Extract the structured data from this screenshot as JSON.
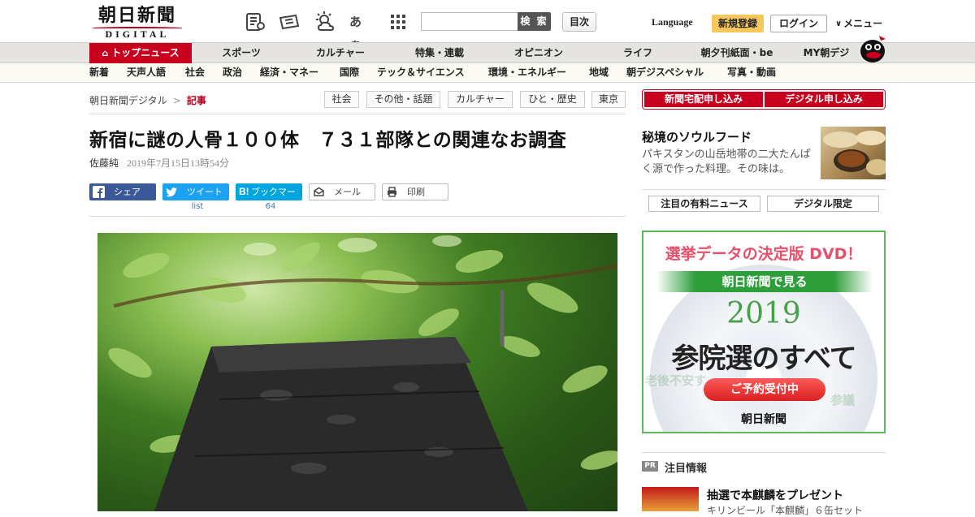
{
  "header": {
    "logo_jp": "朝日新聞",
    "logo_en": "DIGITAL",
    "font_icon_label": "あぁ",
    "search": {
      "placeholder": "",
      "button_label": "検 索"
    },
    "toc_label": "目次",
    "language_label": "Language",
    "register_label": "新規登録",
    "login_label": "ログイン",
    "menu_label": "メニュー"
  },
  "nav_primary": [
    {
      "label": "トップニュース",
      "active": true
    },
    {
      "label": "スポーツ"
    },
    {
      "label": "カルチャー"
    },
    {
      "label": "特集・連載"
    },
    {
      "label": "オピニオン"
    },
    {
      "label": "ライフ"
    },
    {
      "label": "朝夕刊紙面・be"
    },
    {
      "label": "MY朝デジ"
    }
  ],
  "nav_secondary": [
    "新着",
    "天声人語",
    "社会",
    "政治",
    "経済・マネー",
    "国際",
    "テック＆サイエンス",
    "環境・エネルギー",
    "地域",
    "朝デジスペシャル",
    "写真・動画"
  ],
  "breadcrumb": {
    "home": "朝日新聞デジタル",
    "separator": ">",
    "current": "記事"
  },
  "tags": [
    "社会",
    "その他・話題",
    "カルチャー",
    "ひと・歴史",
    "東京"
  ],
  "article": {
    "headline": "新宿に謎の人骨１００体　７３１部隊との関連なお調査",
    "author": "佐藤純",
    "date": "2019年7月15日13時54分",
    "share": {
      "facebook_label": "シェア",
      "twitter_label": "ツイート",
      "twitter_count": "list",
      "hatena_label": "ブックマーク",
      "hatena_count": "64",
      "mail_label": "メール",
      "print_label": "印刷"
    }
  },
  "sidebar": {
    "subscribe_paper": "新聞宅配申し込み",
    "subscribe_digital": "デジタル申し込み",
    "feature": {
      "title": "秘境のソウルフード",
      "text": "パキスタンの山岳地帯の二大たんぱく源で作った料理。その味は。"
    },
    "tabs": [
      "注目の有料ニュース",
      "デジタル限定"
    ],
    "ad": {
      "headline": "選挙データの決定版 DVD！",
      "banner": "朝日新聞で見る",
      "year": "2019",
      "title": "参院選のすべて",
      "cta": "ご予約受付中",
      "brand": "朝日新聞"
    },
    "pr": {
      "badge": "PR",
      "title": "注目情報",
      "promo_title": "抽選で本麒麟をプレゼント",
      "promo_sub": "キリンビール「本麒麟」６缶セット"
    }
  },
  "colors": {
    "brand_red": "#c8001e",
    "register_yellow": "#f6c75a",
    "facebook": "#3b5998",
    "twitter": "#1da1f2",
    "hatena": "#00a4de",
    "ad_green": "#5cb85c"
  }
}
